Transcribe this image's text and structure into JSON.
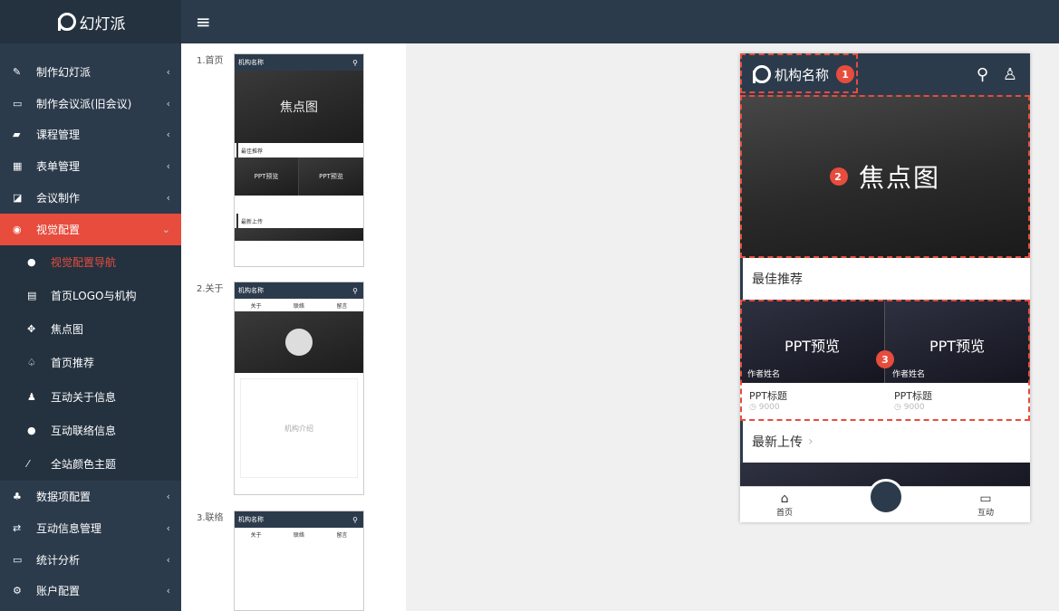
{
  "app": {
    "name": "幻灯派"
  },
  "sidebar": {
    "items": [
      {
        "icon": "edit-icon",
        "label": "制作幻灯派",
        "chev": "‹"
      },
      {
        "icon": "monitor-icon",
        "label": "制作会议派(旧会议)",
        "chev": "‹"
      },
      {
        "icon": "book-icon",
        "label": "课程管理",
        "chev": "‹"
      },
      {
        "icon": "table-icon",
        "label": "表单管理",
        "chev": "‹"
      },
      {
        "icon": "pencil-square-icon",
        "label": "会议制作",
        "chev": "‹"
      },
      {
        "icon": "eye-icon",
        "label": "视觉配置",
        "chev": "⌄"
      }
    ],
    "subitems": [
      {
        "icon": "info-icon",
        "label": "视觉配置导航"
      },
      {
        "icon": "list-icon",
        "label": "首页LOGO与机构"
      },
      {
        "icon": "crosshair-icon",
        "label": "焦点图"
      },
      {
        "icon": "thumbs-up-icon",
        "label": "首页推荐"
      },
      {
        "icon": "user-icon",
        "label": "互动关于信息"
      },
      {
        "icon": "info-icon",
        "label": "互动联络信息"
      },
      {
        "icon": "wand-icon",
        "label": "全站颜色主题"
      }
    ],
    "items2": [
      {
        "icon": "sitemap-icon",
        "label": "数据项配置",
        "chev": "‹"
      },
      {
        "icon": "exchange-icon",
        "label": "互动信息管理",
        "chev": "‹"
      },
      {
        "icon": "desktop-icon",
        "label": "统计分析",
        "chev": "‹"
      },
      {
        "icon": "cogs-icon",
        "label": "账户配置",
        "chev": "‹"
      }
    ]
  },
  "thumbs": {
    "l1": "1.首页",
    "l2": "2.关于",
    "l3": "3.联络",
    "org": "机构名称",
    "focus": "焦点图",
    "best": "最佳推荐",
    "ppt": "PPT预览",
    "latest": "最新上传",
    "about": "关于",
    "contact": "联络",
    "msg": "留言",
    "intro": "机构介绍"
  },
  "phone": {
    "org": "机构名称",
    "focus": "焦点图",
    "best": "最佳推荐",
    "latest": "最新上传",
    "ppt": "PPT预览",
    "author": "作者姓名",
    "title": "PPT标题",
    "views": "9000",
    "home": "首页",
    "interact": "互动",
    "b1": "1",
    "b2": "2",
    "b3": "3"
  }
}
